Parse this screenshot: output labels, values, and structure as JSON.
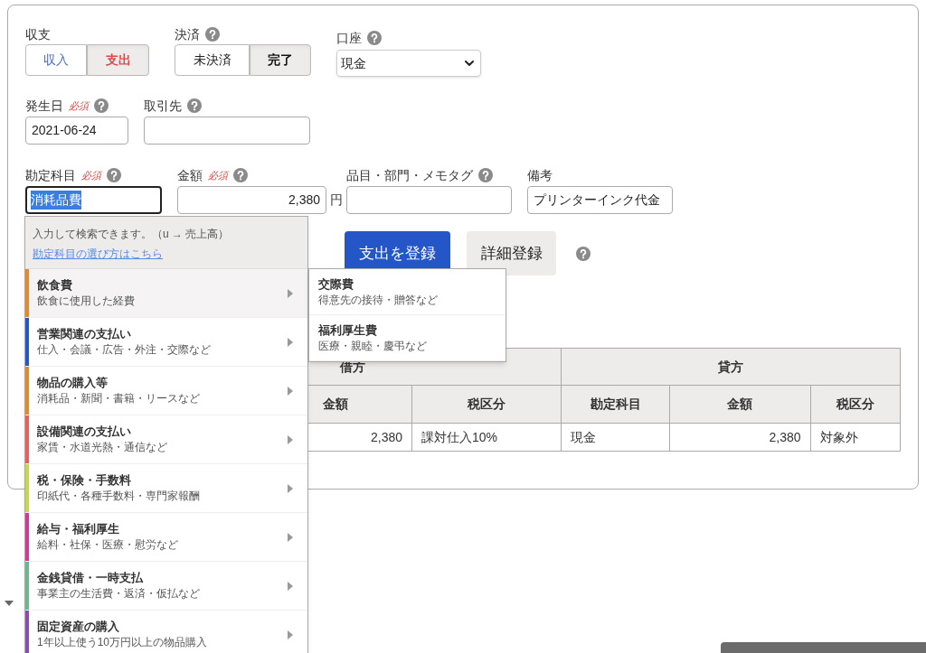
{
  "income_expense": {
    "label": "収支",
    "options": [
      {
        "label": "収入",
        "selected": false
      },
      {
        "label": "支出",
        "selected": true
      }
    ]
  },
  "settlement": {
    "label": "決済",
    "options": [
      {
        "label": "未決済",
        "selected": false
      },
      {
        "label": "完了",
        "selected": true
      }
    ]
  },
  "account": {
    "label": "口座",
    "value": "現金"
  },
  "date": {
    "label": "発生日",
    "required": "必須",
    "value": "2021-06-24"
  },
  "partner": {
    "label": "取引先"
  },
  "category": {
    "label": "勘定科目",
    "required": "必須",
    "value": "消耗品費"
  },
  "amount": {
    "label": "金額",
    "required": "必須",
    "value": "2,380",
    "unit": "円"
  },
  "tags": {
    "label": "品目・部門・メモタグ"
  },
  "memo": {
    "label": "備考",
    "value": "プリンターインク代金"
  },
  "buttons": {
    "primary": "支出を登録",
    "secondary": "詳細登録"
  },
  "journal_table": {
    "groups": [
      "借方",
      "貸方"
    ],
    "columns": [
      "金額",
      "税区分",
      "勘定科目",
      "金額",
      "税区分"
    ],
    "rows": [
      [
        "2,380",
        "課対仕入10%",
        "現金",
        "2,380",
        "対象外"
      ]
    ]
  },
  "dropdown": {
    "hint": "入力して検索できます。（u → 売上高）",
    "link": "勘定科目の選び方はこちら",
    "items": [
      {
        "name": "飲食費",
        "desc": "飲食に使用した経費",
        "color": "#e08a2c",
        "selected": true
      },
      {
        "name": "営業関連の支払い",
        "desc": "仕入・会議・広告・外注・交際など",
        "color": "#2456c8",
        "selected": false
      },
      {
        "name": "物品の購入等",
        "desc": "消耗品・新聞・書籍・リースなど",
        "color": "#e08a2c",
        "selected": false
      },
      {
        "name": "設備関連の支払い",
        "desc": "家賃・水道光熱・通信など",
        "color": "#e8605a",
        "selected": false
      },
      {
        "name": "税・保険・手数料",
        "desc": "印紙代・各種手数料・専門家報酬",
        "color": "#c6d84a",
        "selected": false
      },
      {
        "name": "給与・福利厚生",
        "desc": "給料・社保・医療・慰労など",
        "color": "#d03a96",
        "selected": false
      },
      {
        "name": "金銭貸借・一時支払",
        "desc": "事業主の生活費・返済・仮払など",
        "color": "#6db58a",
        "selected": false
      },
      {
        "name": "固定資産の購入",
        "desc": "1年以上使う10万円以上の物品購入",
        "color": "#8a4cb0",
        "selected": false
      }
    ]
  },
  "submenu": [
    {
      "name": "交際費",
      "desc": "得意先の接待・贈答など"
    },
    {
      "name": "福利厚生費",
      "desc": "医療・親睦・慶弔など"
    }
  ]
}
